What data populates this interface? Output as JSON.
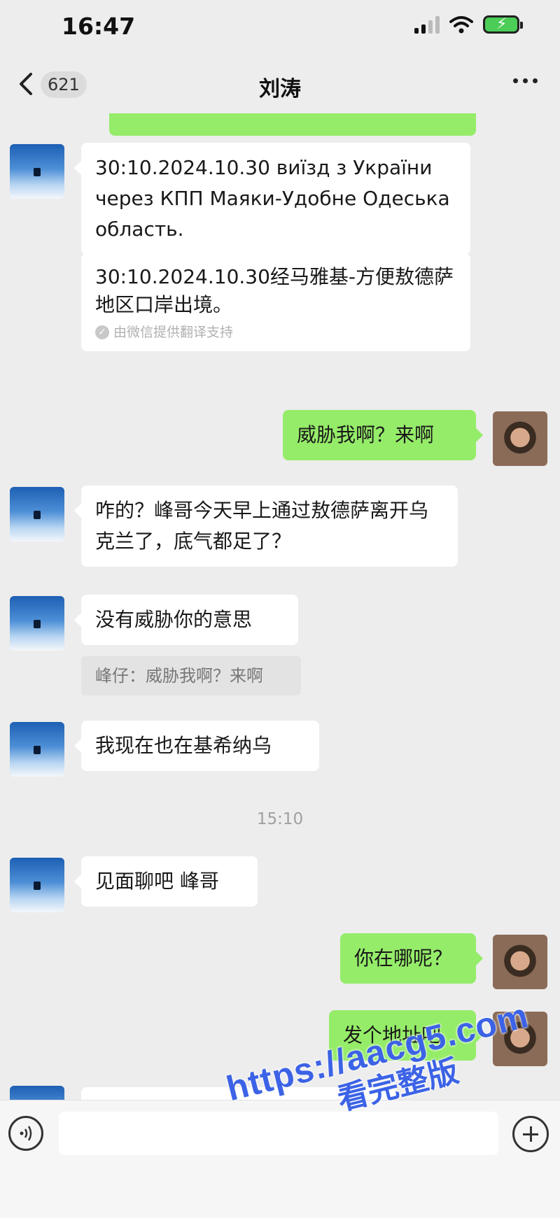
{
  "status_bar": {
    "time": "16:47"
  },
  "nav": {
    "unread_count": "621",
    "title": "刘涛"
  },
  "messages": [
    {
      "from": "contact",
      "text": "30:10.2024.10.30 виїзд з України через КПП Маяки-Удобне Одеська область.",
      "translation": "30:10.2024.10.30经马雅基-方便敖德萨地区口岸出境。",
      "translation_note": "由微信提供翻译支持"
    },
    {
      "from": "me",
      "text": "威胁我啊？来啊"
    },
    {
      "from": "contact",
      "text": "咋的？峰哥今天早上通过敖德萨离开乌克兰了，底气都足了？"
    },
    {
      "from": "contact",
      "text": "没有威胁你的意思",
      "quote": "峰仔：威胁我啊？来啊"
    },
    {
      "from": "contact",
      "text": "我现在也在基希纳乌"
    },
    {
      "type": "time",
      "text": "15:10"
    },
    {
      "from": "contact",
      "text": "见面聊吧 峰哥"
    },
    {
      "from": "me",
      "text": "你在哪呢？"
    },
    {
      "from": "me",
      "text": "发个地址吧"
    }
  ],
  "input": {
    "placeholder": ""
  },
  "watermark": {
    "url": "https://aacg5.com",
    "text": "看完整版"
  },
  "colors": {
    "background": "#ededed",
    "outgoing_bubble": "#95ec69",
    "incoming_bubble": "#ffffff",
    "watermark": "#3c63e6"
  }
}
